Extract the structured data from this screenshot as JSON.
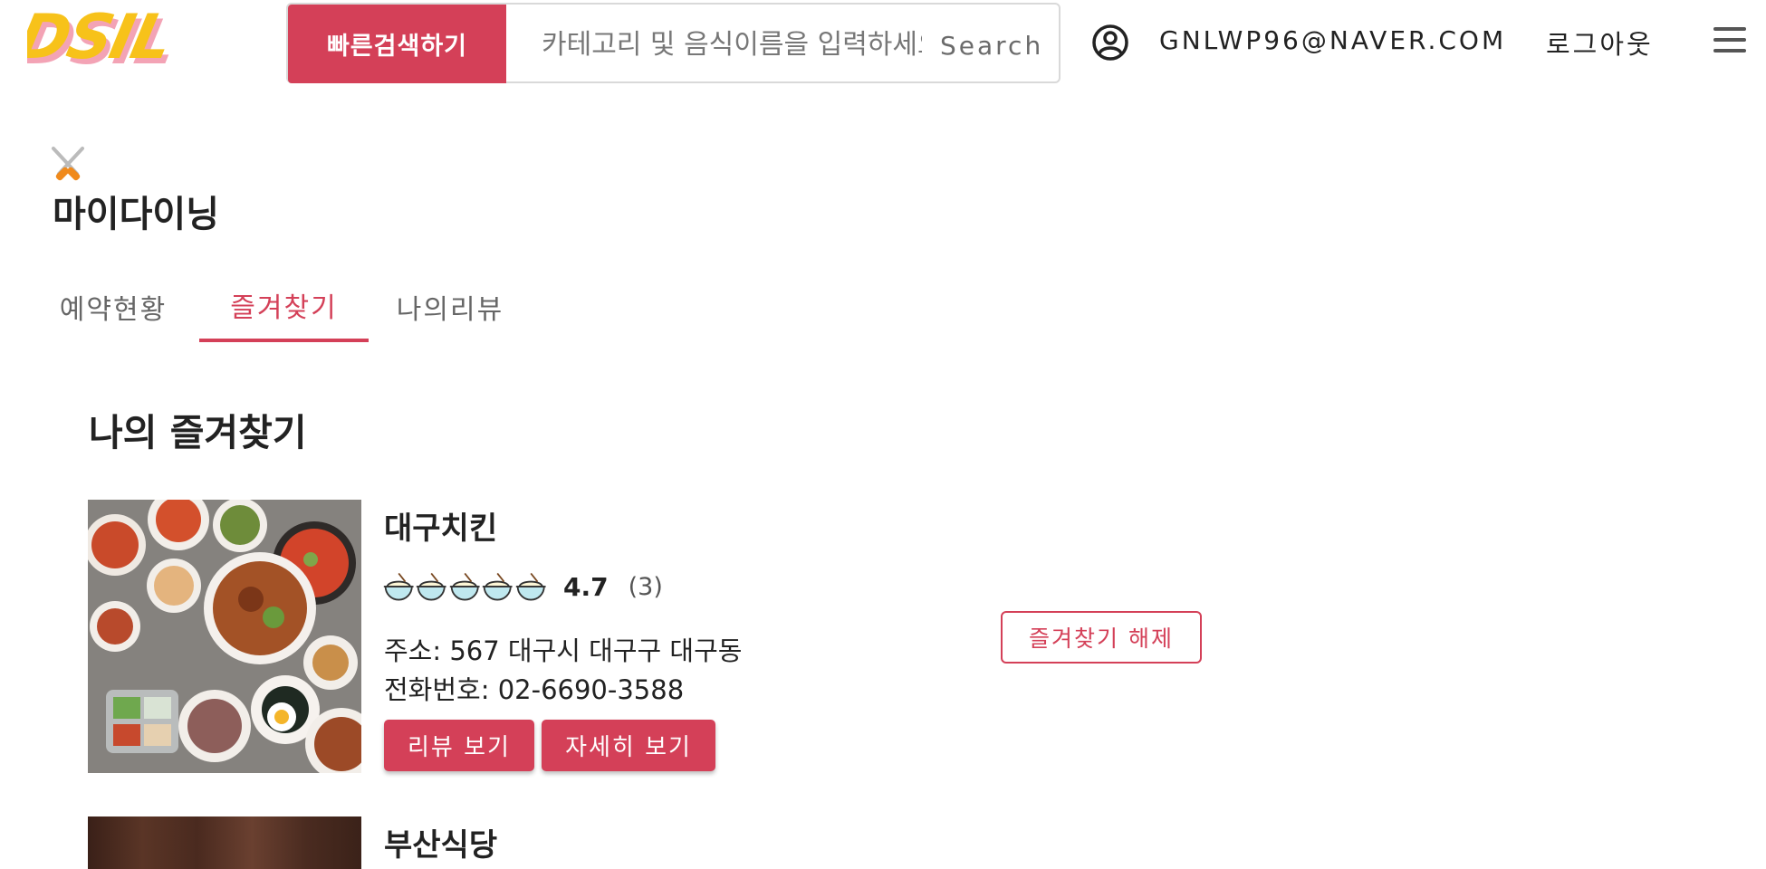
{
  "header": {
    "logo_text": "DSIL",
    "quick_search_label": "빠른검색하기",
    "search_placeholder": "카테고리 및 음식이름을 입력하세요",
    "search_label": "Search",
    "user_email": "GNLWP96@NAVER.COM",
    "logout_label": "로그아웃"
  },
  "page": {
    "title": "마이다이닝"
  },
  "tabs": [
    {
      "label": "예약현황",
      "active": false
    },
    {
      "label": "즐겨찾기",
      "active": true
    },
    {
      "label": "나의리뷰",
      "active": false
    }
  ],
  "favorites": {
    "title": "나의 즐겨찾기",
    "items": [
      {
        "name": "대구치킨",
        "rating": "4.7",
        "review_count": "(3)",
        "address": "주소: 567 대구시 대구구 대구동",
        "phone": "전화번호: 02-6690-3588",
        "review_button": "리뷰 보기",
        "detail_button": "자세히 보기",
        "unfavorite_button": "즐겨찾기 해제"
      },
      {
        "name": "부산식당"
      }
    ]
  },
  "colors": {
    "accent": "#d44058",
    "logo_yellow": "#f7c21a",
    "logo_pink": "#f3a3b5"
  },
  "icons": {
    "user": "user-circle-icon",
    "menu": "hamburger-menu-icon",
    "dining": "fork-spoon-icon",
    "rating": "rice-bowl-icon"
  }
}
